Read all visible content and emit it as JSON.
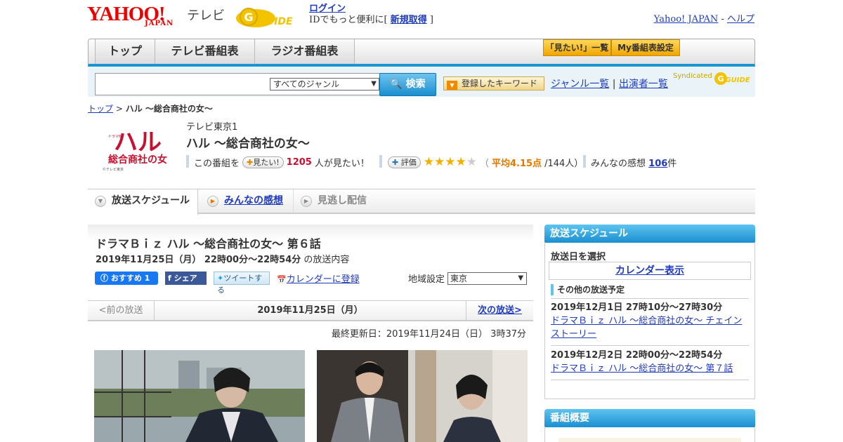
{
  "header": {
    "logo_yahoo": "YAHOO!",
    "logo_japan": "JAPAN",
    "logo_tv": "テレビ",
    "login": "ログイン",
    "id_text_before": "IDでもっと便利に[ ",
    "register": "新規取得",
    "id_text_after": " ]",
    "yahoo_japan": "Yahoo! JAPAN",
    "separator": " - ",
    "help": "ヘルプ"
  },
  "nav": {
    "tabs": [
      "トップ",
      "テレビ番組表",
      "ラジオ番組表"
    ],
    "btn_mitai": "「見たい!」一覧",
    "btn_my": "My番組表設定"
  },
  "search": {
    "genre": "すべてのジャンル",
    "button": "検索",
    "keyword_button": "登録したキーワード",
    "genre_list": "ジャンル一覧",
    "divider": " | ",
    "cast_list": "出演者一覧",
    "syndicated": "Syndicated"
  },
  "breadcrumb": {
    "top": "トップ",
    "sep": " > ",
    "current": "ハル ～総合商社の女～"
  },
  "program": {
    "logo_line1": "ハル",
    "logo_line2": "総合商社の女",
    "logo_copy": "©テレビ東京",
    "logo_tag": "ドラマBiz",
    "channel": "テレビ東京1",
    "title": "ハル ～総合商社の女～",
    "want_prefix": "この番組を",
    "want_button": "見たい!",
    "want_count": "1205",
    "want_suffix": "人が見たい！",
    "rate_button": "評価",
    "rating": 4.15,
    "rating_open": "（",
    "rating_label": "平均4.15点",
    "rating_count": "/144人）",
    "review_label": "みんなの感想",
    "review_count": "106",
    "review_suffix": "件"
  },
  "tabs": {
    "schedule": "放送スケジュール",
    "reviews": "みんなの感想",
    "streaming": "見逃し配信"
  },
  "episode": {
    "title": "ドラマＢｉｚ ハル ～総合商社の女～ 第６話",
    "date": "2019年11月25日（月） 22時00分～22時54分",
    "date_suffix": " の放送内容",
    "fb_recommend": "おすすめ 1",
    "fb_share": "シェア",
    "tweet": "ツイートする",
    "calendar": "カレンダーに登録",
    "region_label": "地域設定",
    "region": "東京",
    "prev": "<前の放送",
    "current_date": "2019年11月25日（月）",
    "next": "次の放送>",
    "updated": "最終更新日：2019年11月24日（日） 3時37分"
  },
  "sidebar": {
    "schedule_head": "放送スケジュール",
    "select_label": "放送日を選択",
    "calendar": "カレンダー表示",
    "other_label": "その他の放送予定",
    "items": [
      {
        "date": "2019年12月1日 27時10分～27時30分",
        "title": "ドラマＢｉｚ ハル ～総合商社の女～ チェインストーリー"
      },
      {
        "date": "2019年12月2日 22時00分～22時54分",
        "title": "ドラマＢｉｚ ハル ～総合商社の女～ 第７話"
      }
    ],
    "overview_head": "番組概要"
  },
  "colors": {
    "accent_blue": "#1796d2",
    "brand_red": "#e00000",
    "link": "#1f3bbd",
    "gold": "#f0a500"
  }
}
